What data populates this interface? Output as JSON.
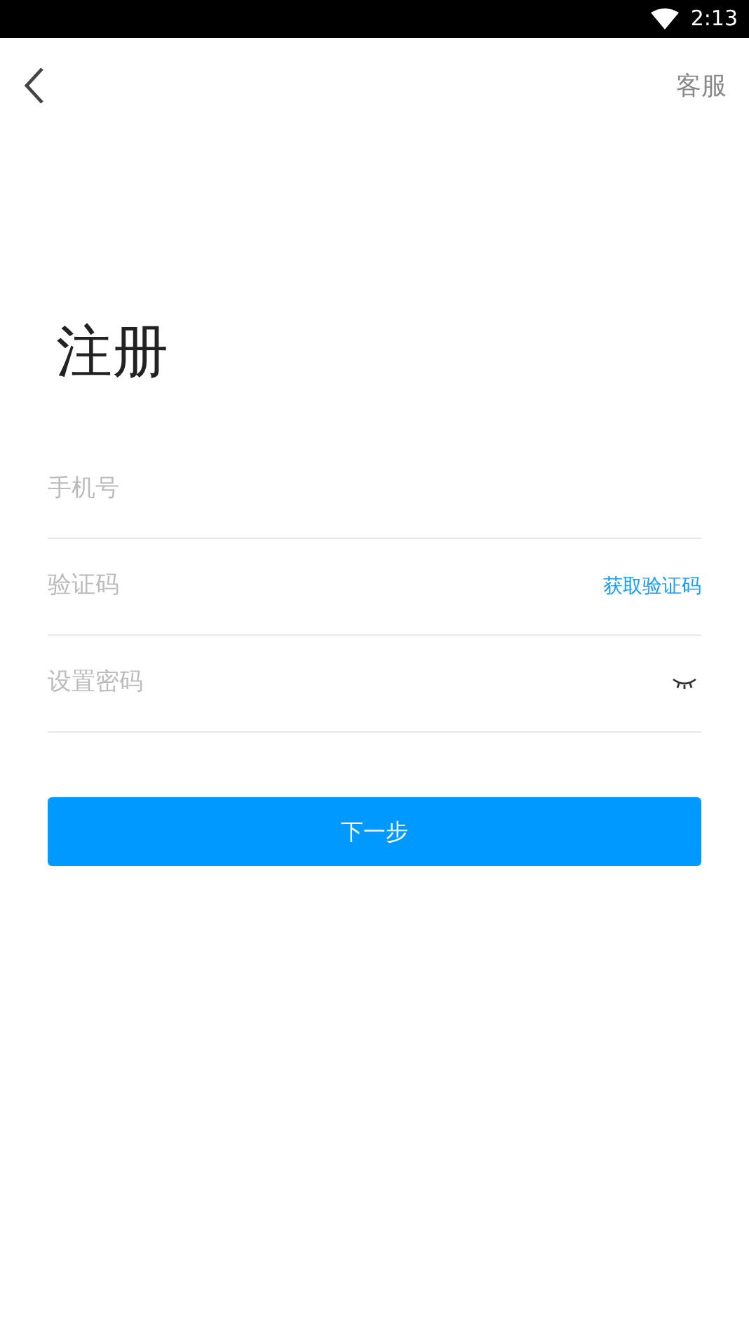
{
  "status_bar": {
    "time": "2:13"
  },
  "header": {
    "service_link": "客服"
  },
  "title": "注册",
  "fields": [
    {
      "kind": "phone",
      "placeholder": "手机号"
    },
    {
      "kind": "code",
      "placeholder": "验证码",
      "action": "获取验证码"
    },
    {
      "kind": "password",
      "placeholder": "设置密码"
    }
  ],
  "submit": "下一步"
}
